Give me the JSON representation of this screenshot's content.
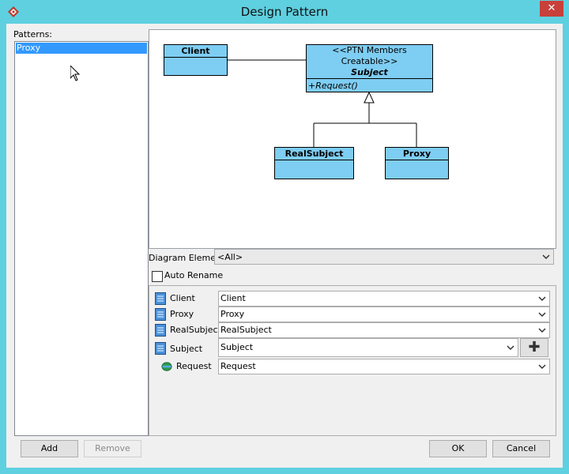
{
  "window": {
    "title": "Design Pattern",
    "close_glyph": "✕"
  },
  "patterns": {
    "label": "Patterns:",
    "items": [
      "Proxy"
    ],
    "selected": "Proxy"
  },
  "diagram": {
    "client": {
      "name": "Client"
    },
    "subject": {
      "stereotype": "<<PTN Members Creatable>>",
      "name": "Subject",
      "operation": "+Request()"
    },
    "real_subject": {
      "name": "RealSubject"
    },
    "proxy": {
      "name": "Proxy"
    }
  },
  "diagram_element": {
    "label": "Diagram Element",
    "value": "<All>"
  },
  "auto_rename": {
    "label": "Auto Rename",
    "checked": false
  },
  "members": [
    {
      "label": "Client",
      "value": "Client",
      "icon": "class-icon"
    },
    {
      "label": "Proxy",
      "value": "Proxy",
      "icon": "class-icon"
    },
    {
      "label": "RealSubject",
      "value": "RealSubject",
      "icon": "class-icon"
    },
    {
      "label": "Subject",
      "value": "Subject",
      "icon": "class-icon",
      "add_glyph": "✚"
    },
    {
      "label": "Request",
      "value": "Request",
      "icon": "operation-icon"
    }
  ],
  "buttons": {
    "add": "Add",
    "remove": "Remove",
    "ok": "OK",
    "cancel": "Cancel"
  }
}
